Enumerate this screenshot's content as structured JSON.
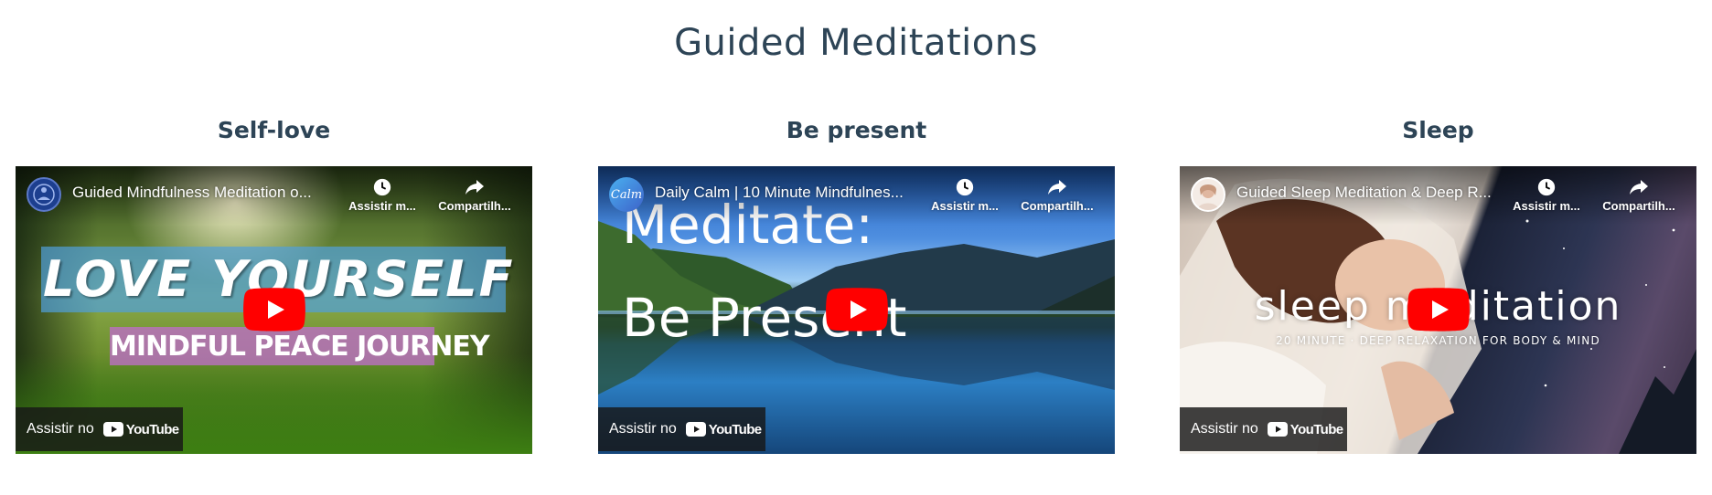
{
  "page": {
    "title": "Guided Meditations"
  },
  "player_ui": {
    "watch_later": "Assistir m...",
    "share": "Compartilh...",
    "watch_on": "Assistir no",
    "youtube": "YouTube"
  },
  "cards": [
    {
      "heading": "Self-love",
      "video_title": "Guided Mindfulness Meditation o...",
      "thumbnail_line1": "LOVE YOURSELF",
      "thumbnail_line2": "MINDFUL PEACE JOURNEY"
    },
    {
      "heading": "Be present",
      "video_title": "Daily Calm | 10 Minute Mindfulnes...",
      "channel_logo_text": "Calm",
      "thumbnail_line1": "Meditate:",
      "thumbnail_line2": "Be Present"
    },
    {
      "heading": "Sleep",
      "video_title": "Guided Sleep Meditation & Deep R...",
      "thumbnail_line1": "sleep meditation",
      "thumbnail_line2": "20 MINUTE · DEEP RELAXATION FOR BODY & MIND"
    }
  ],
  "colors": {
    "heading": "#2d4456",
    "youtube_red": "#ff0000"
  }
}
